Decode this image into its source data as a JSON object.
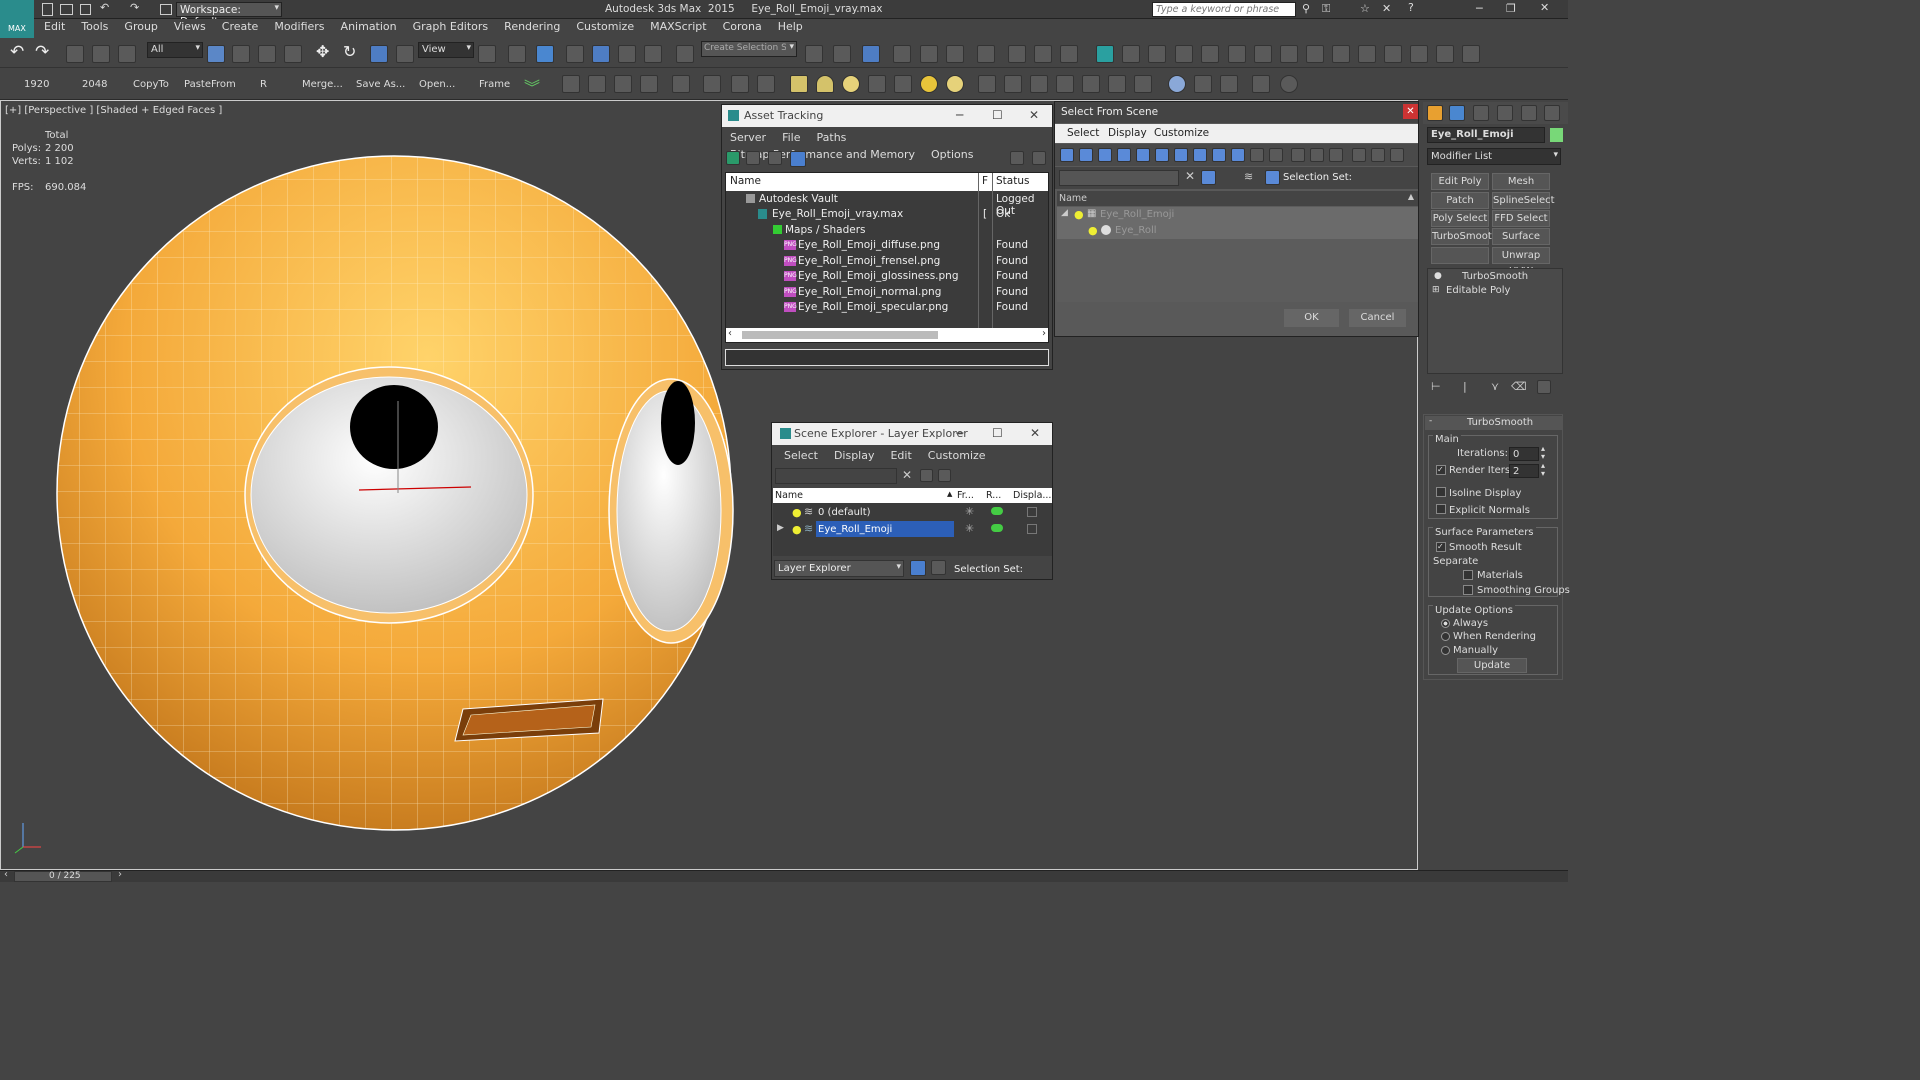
{
  "app": {
    "logo_text": "MAX",
    "workspace_label": "Workspace: Default",
    "title": "Autodesk 3ds Max  2015     Eye_Roll_Emoji_vray.max",
    "search_placeholder": "Type a keyword or phrase"
  },
  "menu": [
    "Edit",
    "Tools",
    "Group",
    "Views",
    "Create",
    "Modifiers",
    "Animation",
    "Graph Editors",
    "Rendering",
    "Customize",
    "MAXScript",
    "Corona",
    "Help"
  ],
  "toolbar": {
    "selection_filter": "All",
    "ref_coord": "View",
    "selection_set_placeholder": "Create Selection Se",
    "shelf": [
      "1920",
      "2048",
      "CopyTo",
      "PasteFrom",
      "R",
      "Merge...",
      "Save As...",
      "Open...",
      "Frame"
    ]
  },
  "viewport": {
    "label": "[+] [Perspective ] [Shaded + Edged Faces ]",
    "stats": {
      "total_label": "Total",
      "polys_label": "Polys:",
      "polys": "2 200",
      "verts_label": "Verts:",
      "verts": "1 102",
      "fps_label": "FPS:",
      "fps": "690.084"
    }
  },
  "asset_tracking": {
    "title": "Asset Tracking",
    "menu": [
      "Server",
      "File",
      "Paths",
      "Bitmap Performance and Memory",
      "Options"
    ],
    "columns": [
      "Name",
      "F",
      "Status"
    ],
    "rows": [
      {
        "name": "Autodesk Vault",
        "f": "",
        "status": "Logged Out"
      },
      {
        "name": "Eye_Roll_Emoji_vray.max",
        "f": "[",
        "status": "Ok"
      },
      {
        "name": "Maps / Shaders",
        "f": "",
        "status": ""
      },
      {
        "name": "Eye_Roll_Emoji_diffuse.png",
        "f": "",
        "status": "Found"
      },
      {
        "name": "Eye_Roll_Emoji_frensel.png",
        "f": "",
        "status": "Found"
      },
      {
        "name": "Eye_Roll_Emoji_glossiness.png",
        "f": "",
        "status": "Found"
      },
      {
        "name": "Eye_Roll_Emoji_normal.png",
        "f": "",
        "status": "Found"
      },
      {
        "name": "Eye_Roll_Emoji_specular.png",
        "f": "",
        "status": "Found"
      }
    ],
    "png_badge": "PNG"
  },
  "select_from_scene": {
    "title": "Select From Scene",
    "menu": [
      "Select",
      "Display",
      "Customize"
    ],
    "selection_set_label": "Selection Set:",
    "column_name": "Name",
    "items": [
      "Eye_Roll_Emoji",
      "Eye_Roll"
    ],
    "ok": "OK",
    "cancel": "Cancel"
  },
  "layer_explorer": {
    "title": "Scene Explorer - Layer Explorer",
    "menu": [
      "Select",
      "Display",
      "Edit",
      "Customize"
    ],
    "columns": [
      "Name",
      "Fr...",
      "R...",
      "Displa..."
    ],
    "rows": [
      "0 (default)",
      "Eye_Roll_Emoji"
    ],
    "footer_dropdown": "Layer Explorer",
    "selection_set_label": "Selection Set:"
  },
  "command_panel": {
    "object_name": "Eye_Roll_Emoji",
    "modifier_list": "Modifier List",
    "modifier_buttons": [
      "Edit Poly",
      "Mesh Select",
      "Patch Select",
      "SplineSelect",
      "Poly Select",
      "FFD Select",
      "TurboSmooth",
      "Surface Select",
      "",
      "Unwrap UVW"
    ],
    "stack": [
      "TurboSmooth",
      "Editable Poly"
    ],
    "rollout_title": "TurboSmooth",
    "main_label": "Main",
    "iterations_label": "Iterations:",
    "iterations": "0",
    "render_iters_label": "Render Iters:",
    "render_iters": "2",
    "isoline": "Isoline Display",
    "explicit_normals": "Explicit Normals",
    "surface_params": "Surface Parameters",
    "smooth_result": "Smooth Result",
    "separate": "Separate",
    "materials": "Materials",
    "smoothing_groups": "Smoothing Groups",
    "update_options": "Update Options",
    "always": "Always",
    "when_rendering": "When Rendering",
    "manually": "Manually",
    "update_btn": "Update"
  },
  "status": {
    "frame": "0 / 225"
  },
  "colors": {
    "accent": "#3a6fd8",
    "emoji": "#f4a93a",
    "selection": "#2c5fb8"
  }
}
